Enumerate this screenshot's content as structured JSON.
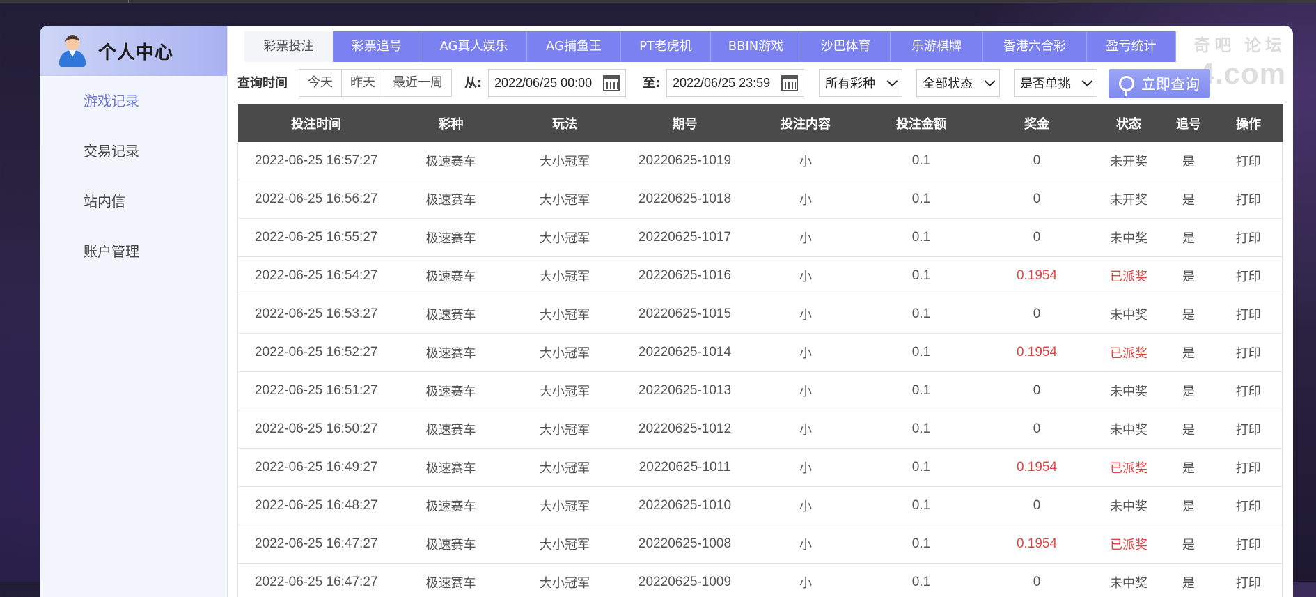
{
  "sidebar": {
    "title": "个人中心",
    "items": [
      {
        "label": "游戏记录",
        "active": true
      },
      {
        "label": "交易记录",
        "active": false
      },
      {
        "label": "站内信",
        "active": false
      },
      {
        "label": "账户管理",
        "active": false
      }
    ]
  },
  "tabs": [
    {
      "label": "彩票投注",
      "active": true
    },
    {
      "label": "彩票追号",
      "active": false
    },
    {
      "label": "AG真人娱乐",
      "active": false
    },
    {
      "label": "AG捕鱼王",
      "active": false
    },
    {
      "label": "PT老虎机",
      "active": false
    },
    {
      "label": "BBIN游戏",
      "active": false
    },
    {
      "label": "沙巴体育",
      "active": false
    },
    {
      "label": "乐游棋牌",
      "active": false
    },
    {
      "label": "香港六合彩",
      "active": false
    },
    {
      "label": "盈亏统计",
      "active": false
    }
  ],
  "filter": {
    "query_time_label": "查询时间",
    "quick": [
      "今天",
      "昨天",
      "最近一周"
    ],
    "from_label": "从:",
    "from_value": "2022/06/25 00:00",
    "to_label": "至:",
    "to_value": "2022/06/25 23:59",
    "lottery_select": "所有彩种",
    "status_select": "全部状态",
    "single_select": "是否单挑",
    "query_button": "立即查询"
  },
  "watermark": {
    "line1": "奇吧 论坛",
    "line2": "4.com"
  },
  "table": {
    "headers": [
      "投注时间",
      "彩种",
      "玩法",
      "期号",
      "投注内容",
      "投注金额",
      "奖金",
      "状态",
      "追号",
      "操作"
    ],
    "rows": [
      [
        "2022-06-25 16:57:27",
        "极速赛车",
        "大小冠军",
        "20220625-1019",
        "小",
        "0.1",
        "0",
        "未开奖",
        "是",
        "打印"
      ],
      [
        "2022-06-25 16:56:27",
        "极速赛车",
        "大小冠军",
        "20220625-1018",
        "小",
        "0.1",
        "0",
        "未开奖",
        "是",
        "打印"
      ],
      [
        "2022-06-25 16:55:27",
        "极速赛车",
        "大小冠军",
        "20220625-1017",
        "小",
        "0.1",
        "0",
        "未中奖",
        "是",
        "打印"
      ],
      [
        "2022-06-25 16:54:27",
        "极速赛车",
        "大小冠军",
        "20220625-1016",
        "小",
        "0.1",
        "0.1954",
        "已派奖",
        "是",
        "打印"
      ],
      [
        "2022-06-25 16:53:27",
        "极速赛车",
        "大小冠军",
        "20220625-1015",
        "小",
        "0.1",
        "0",
        "未中奖",
        "是",
        "打印"
      ],
      [
        "2022-06-25 16:52:27",
        "极速赛车",
        "大小冠军",
        "20220625-1014",
        "小",
        "0.1",
        "0.1954",
        "已派奖",
        "是",
        "打印"
      ],
      [
        "2022-06-25 16:51:27",
        "极速赛车",
        "大小冠军",
        "20220625-1013",
        "小",
        "0.1",
        "0",
        "未中奖",
        "是",
        "打印"
      ],
      [
        "2022-06-25 16:50:27",
        "极速赛车",
        "大小冠军",
        "20220625-1012",
        "小",
        "0.1",
        "0",
        "未中奖",
        "是",
        "打印"
      ],
      [
        "2022-06-25 16:49:27",
        "极速赛车",
        "大小冠军",
        "20220625-1011",
        "小",
        "0.1",
        "0.1954",
        "已派奖",
        "是",
        "打印"
      ],
      [
        "2022-06-25 16:48:27",
        "极速赛车",
        "大小冠军",
        "20220625-1010",
        "小",
        "0.1",
        "0",
        "未中奖",
        "是",
        "打印"
      ],
      [
        "2022-06-25 16:47:27",
        "极速赛车",
        "大小冠军",
        "20220625-1008",
        "小",
        "0.1",
        "0.1954",
        "已派奖",
        "是",
        "打印"
      ],
      [
        "2022-06-25 16:47:27",
        "极速赛车",
        "大小冠军",
        "20220625-1009",
        "小",
        "0.1",
        "0",
        "未中奖",
        "是",
        "打印"
      ]
    ],
    "highlight_color": "#e04444",
    "header_bg": "#4a4a4a"
  },
  "colors": {
    "accent": "#7b81f0",
    "sidebar_active": "#6d74d8"
  }
}
